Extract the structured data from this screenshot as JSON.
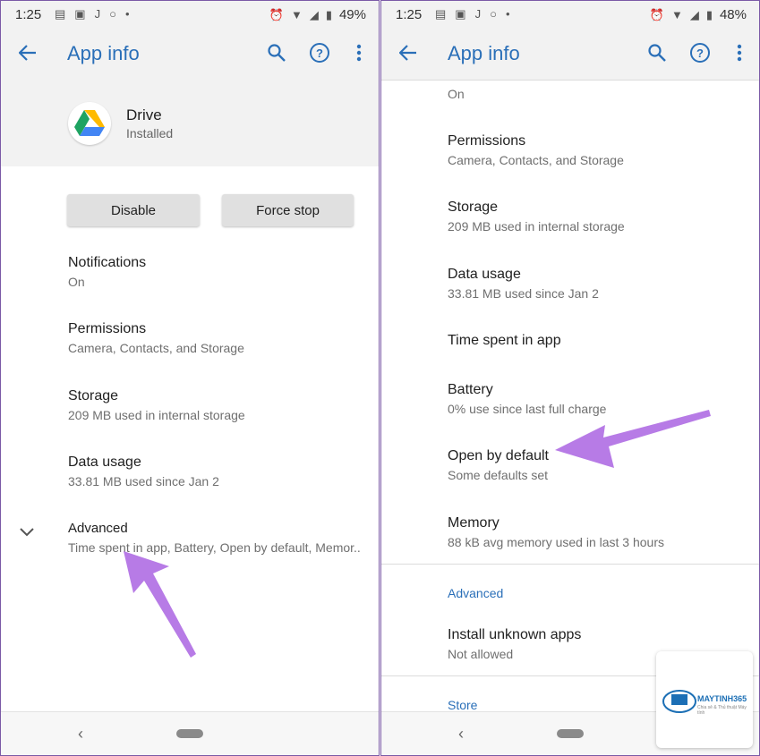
{
  "left": {
    "status": {
      "time": "1:25",
      "battery": "49%"
    },
    "appbar": {
      "title": "App info"
    },
    "app": {
      "name": "Drive",
      "status": "Installed"
    },
    "buttons": {
      "disable": "Disable",
      "force_stop": "Force stop"
    },
    "items": [
      {
        "title": "Notifications",
        "sub": "On"
      },
      {
        "title": "Permissions",
        "sub": "Camera, Contacts, and Storage"
      },
      {
        "title": "Storage",
        "sub": "209 MB used in internal storage"
      },
      {
        "title": "Data usage",
        "sub": "33.81 MB used since Jan 2"
      },
      {
        "title": "Advanced",
        "sub": "Time spent in app, Battery, Open by default, Memor.."
      }
    ]
  },
  "right": {
    "status": {
      "time": "1:25",
      "battery": "48%"
    },
    "appbar": {
      "title": "App info"
    },
    "top_sub": "On",
    "items": [
      {
        "title": "Permissions",
        "sub": "Camera, Contacts, and Storage"
      },
      {
        "title": "Storage",
        "sub": "209 MB used in internal storage"
      },
      {
        "title": "Data usage",
        "sub": "33.81 MB used since Jan 2"
      },
      {
        "title": "Time spent in app"
      },
      {
        "title": "Battery",
        "sub": "0% use since last full charge"
      },
      {
        "title": "Open by default",
        "sub": "Some defaults set"
      },
      {
        "title": "Memory",
        "sub": "88 kB avg memory used in last 3 hours"
      }
    ],
    "advanced_label": "Advanced",
    "install_unknown": {
      "title": "Install unknown apps",
      "sub": "Not allowed"
    },
    "store_label": "Store"
  },
  "watermark": {
    "brand": "MAYTINH365",
    "tagline": "Chia sẻ & Thủ thuật Máy tính"
  },
  "colors": {
    "accent": "#2a6fb8",
    "arrow": "#b77be6",
    "drive_green": "#1ea362",
    "drive_yellow": "#ffba00",
    "drive_blue": "#4285f4"
  },
  "icons": [
    "back-arrow-icon",
    "search-icon",
    "help-icon",
    "more-vert-icon",
    "chevron-down-icon",
    "drive-logo-icon"
  ]
}
